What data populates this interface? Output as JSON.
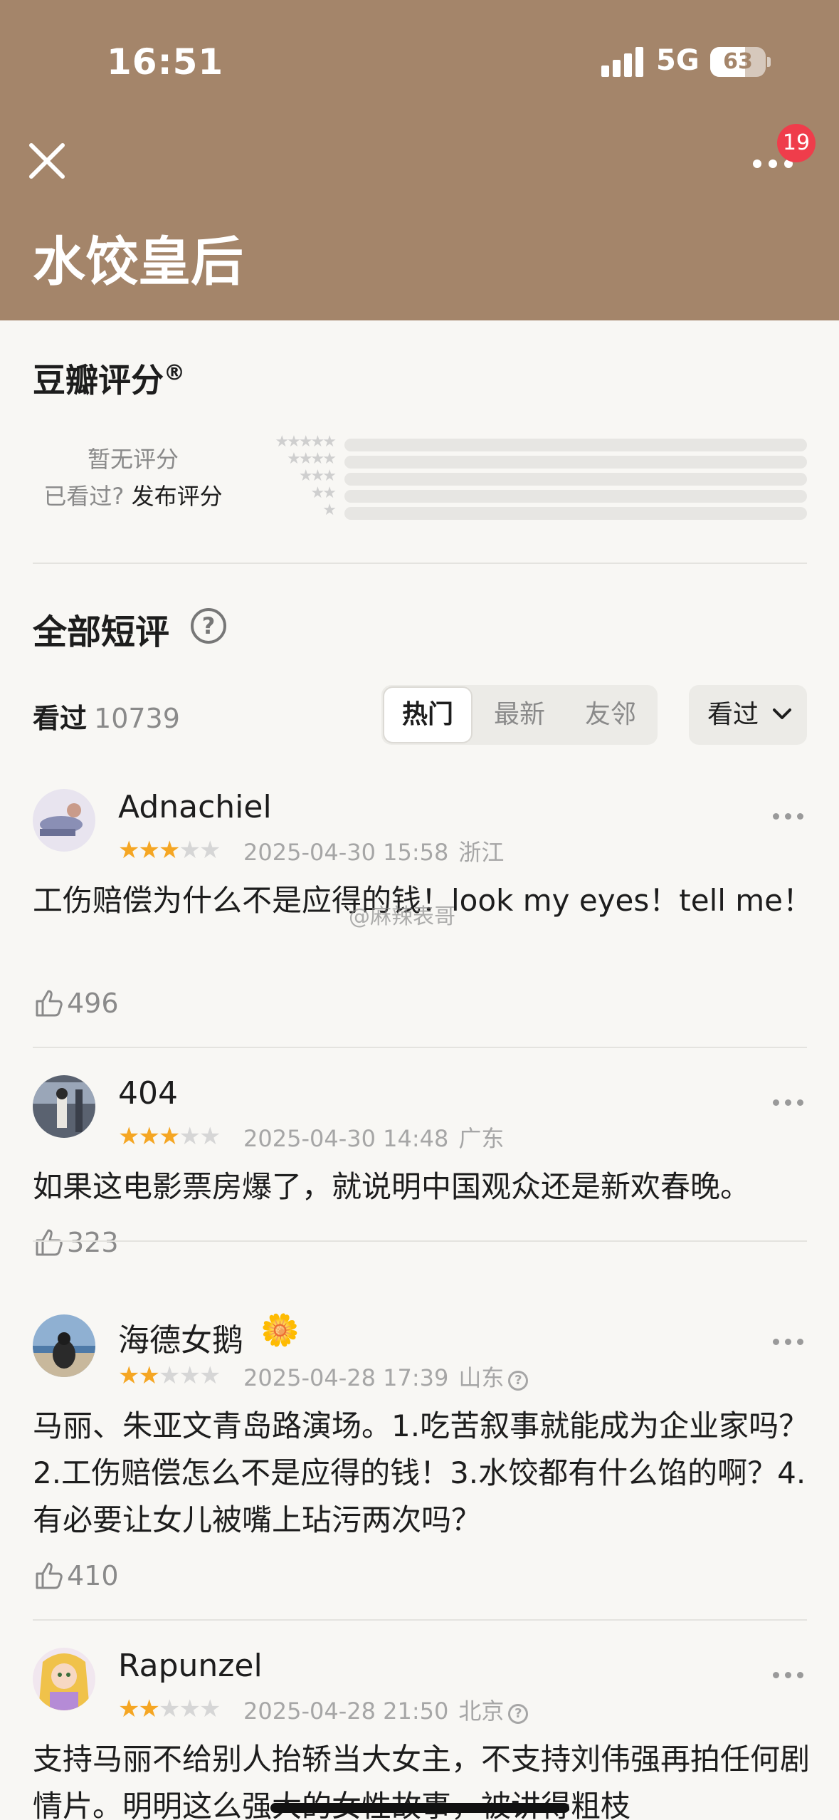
{
  "status_bar": {
    "time": "16:51",
    "network": "5G",
    "battery": "63",
    "battery_level": 0.63
  },
  "header": {
    "title": "水饺皇后",
    "badge_count": "19",
    "close_icon": "close-icon",
    "more_icon": "more-icon",
    "bg_color": "#a4856a"
  },
  "rating": {
    "title": "豆瓣评分",
    "registered_mark": "®",
    "no_rating": "暂无评分",
    "seen_prompt": "已看过?",
    "post_rating": "发布评分",
    "star_levels": [
      5,
      4,
      3,
      2,
      1
    ]
  },
  "comments_header": {
    "title": "全部短评",
    "help_icon": "?",
    "seen_label": "看过",
    "seen_count": "10739",
    "tabs": [
      "热门",
      "最新",
      "友邻"
    ],
    "active_tab": "热门",
    "sort_label": "看过"
  },
  "comments": [
    {
      "user": "Adnachiel",
      "stars": 3,
      "date": "2025-04-30 15:58",
      "location": "浙江",
      "text": "工伤赔偿为什么不是应得的钱！look my eyes！tell me！",
      "likes": "496",
      "has_info": false
    },
    {
      "user": "404",
      "stars": 3,
      "date": "2025-04-30 14:48",
      "location": "广东",
      "text": "如果这电影票房爆了，就说明中国观众还是新欢春晚。",
      "likes": "323",
      "has_info": false
    },
    {
      "user": "海德女鹅",
      "badge": "🌼",
      "stars": 2,
      "date": "2025-04-28 17:39",
      "location": "山东",
      "text": "马丽、朱亚文青岛路演场。1.吃苦叙事就能成为企业家吗？2.工伤赔偿怎么不是应得的钱！3.水饺都有什么馅的啊？4.有必要让女儿被嘴上玷污两次吗？",
      "likes": "410",
      "has_info": true
    },
    {
      "user": "Rapunzel",
      "stars": 2,
      "date": "2025-04-28 21:50",
      "location": "北京",
      "text": "支持马丽不给别人抬轿当大女主，不支持刘伟强再拍任何剧情片。明明这么强大的女性故事，被讲得粗枝",
      "likes": "",
      "has_info": true
    }
  ],
  "watermark": "@麻辣表哥",
  "colors": {
    "star_on": "#f5a623",
    "star_off": "#d6d6d6",
    "badge": "#ef3d4b"
  }
}
